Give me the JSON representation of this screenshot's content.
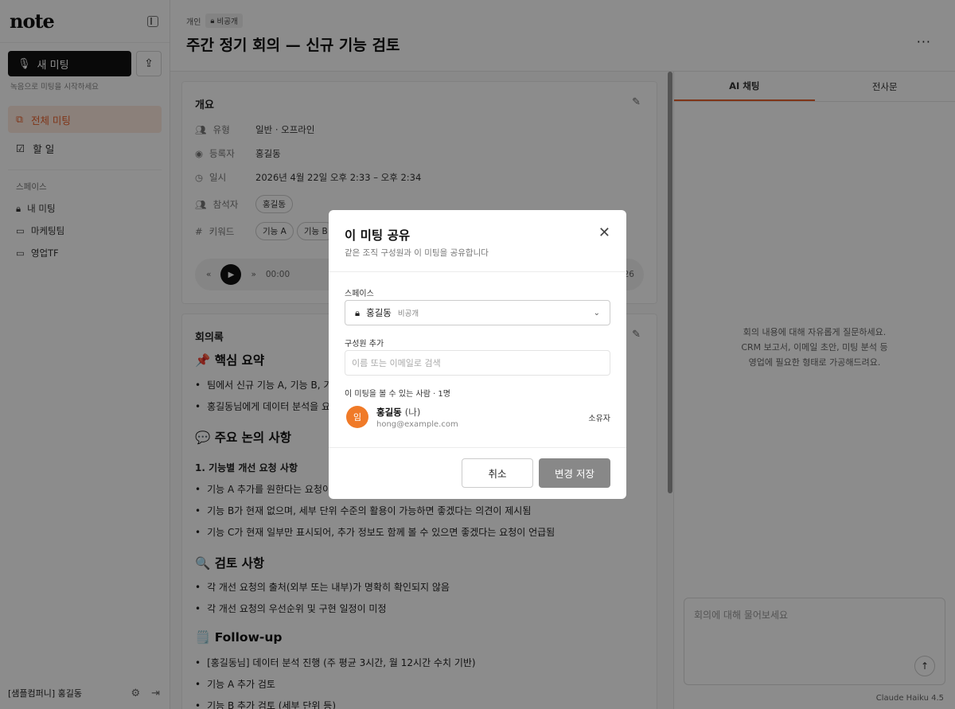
{
  "sidebar": {
    "logo": "note",
    "new_meeting_label": "새 미팅",
    "new_meeting_hint": "녹음으로 미팅을 시작하세요",
    "nav": [
      {
        "label": "전체 미팅",
        "icon": "documents-icon",
        "active": true
      },
      {
        "label": "할 일",
        "icon": "checkbox-icon",
        "active": false
      }
    ],
    "spaces_label": "스페이스",
    "spaces": [
      {
        "label": "내 미팅",
        "icon": "lock-icon"
      },
      {
        "label": "마케팅팀",
        "icon": "folder-icon"
      },
      {
        "label": "영업TF",
        "icon": "folder-icon"
      }
    ],
    "footer_user": "[샘플컴퍼니] 홍길동"
  },
  "header": {
    "breadcrumb_space": "개인",
    "privacy_chip": "비공개",
    "title": "주간 정기 회의 — 신규 기능 검토",
    "more": "···"
  },
  "overview": {
    "title": "개요",
    "rows": [
      {
        "label": "유형",
        "value": "일반 · 오프라인"
      },
      {
        "label": "등록자",
        "value": "홍길동"
      },
      {
        "label": "일시",
        "value": "2026년 4월 22일 오후 2:33 – 오후 2:34"
      },
      {
        "label": "참석자",
        "value": "홍길동"
      },
      {
        "label": "키워드",
        "values": [
          "기능 A",
          "기능 B"
        ]
      }
    ],
    "player_time": "00:00",
    "player_end": "26"
  },
  "minutes": {
    "title": "회의록",
    "summary_heading": "📌 핵심 요약",
    "summary_bullets": [
      "팀에서 신규 기능 A, 기능 B, 기",
      "홍길동님에게 데이터 분석을 요"
    ],
    "discussion_heading": "💬 주요 논의 사항",
    "discussion_sub": "1. 기능별 개선 요청 사항",
    "discussion_bullets": [
      "기능 A 추가를 원한다는 요청이",
      "기능 B가 현재 없으며, 세부 단위 수준의 활용이 가능하면 좋겠다는 의견이 제시됨",
      "기능 C가 현재 일부만 표시되어, 추가 정보도 함께 볼 수 있으면 좋겠다는 요청이 언급됨"
    ],
    "review_heading": "🔍 검토 사항",
    "review_bullets": [
      "각 개선 요청의 출처(외부 또는 내부)가 명확히 확인되지 않음",
      "각 개선 요청의 우선순위 및 구현 일정이 미정"
    ],
    "followup_heading": "🗒️ Follow-up",
    "followup_bullets": [
      "[홍길동님] 데이터 분석 진행 (주 평균 3시간, 월 12시간 수치 기반)",
      "기능 A 추가 검토",
      "기능 B 추가 검토 (세부 단위 등)"
    ]
  },
  "right_panel": {
    "tabs": [
      "AI 채팅",
      "전사문"
    ],
    "empty_lines": [
      "회의 내용에 대해 자유롭게 질문하세요.",
      "CRM 보고서, 이메일 초안, 미팅 분석 등",
      "영업에 필요한 형태로 가공해드려요."
    ],
    "chat_placeholder": "회의에 대해 물어보세요",
    "model": "Claude Haiku 4.5"
  },
  "modal": {
    "title": "이 미팅 공유",
    "subtitle": "같은 조직 구성원과 이 미팅을 공유합니다",
    "space_label": "스페이스",
    "space_value": "홍길동",
    "space_privacy": "비공개",
    "add_member_label": "구성원 추가",
    "add_member_placeholder": "이름 또는 이메일로 검색",
    "viewers_label": "이 미팅을 볼 수 있는 사람 · 1명",
    "member": {
      "avatar": "임",
      "name": "홍길동",
      "me": "(나)",
      "email": "hong@example.com",
      "role": "소유자"
    },
    "cancel_label": "취소",
    "save_label": "변경 저장"
  },
  "colors": {
    "accent": "#e8612c",
    "avatar": "#f07a28"
  }
}
